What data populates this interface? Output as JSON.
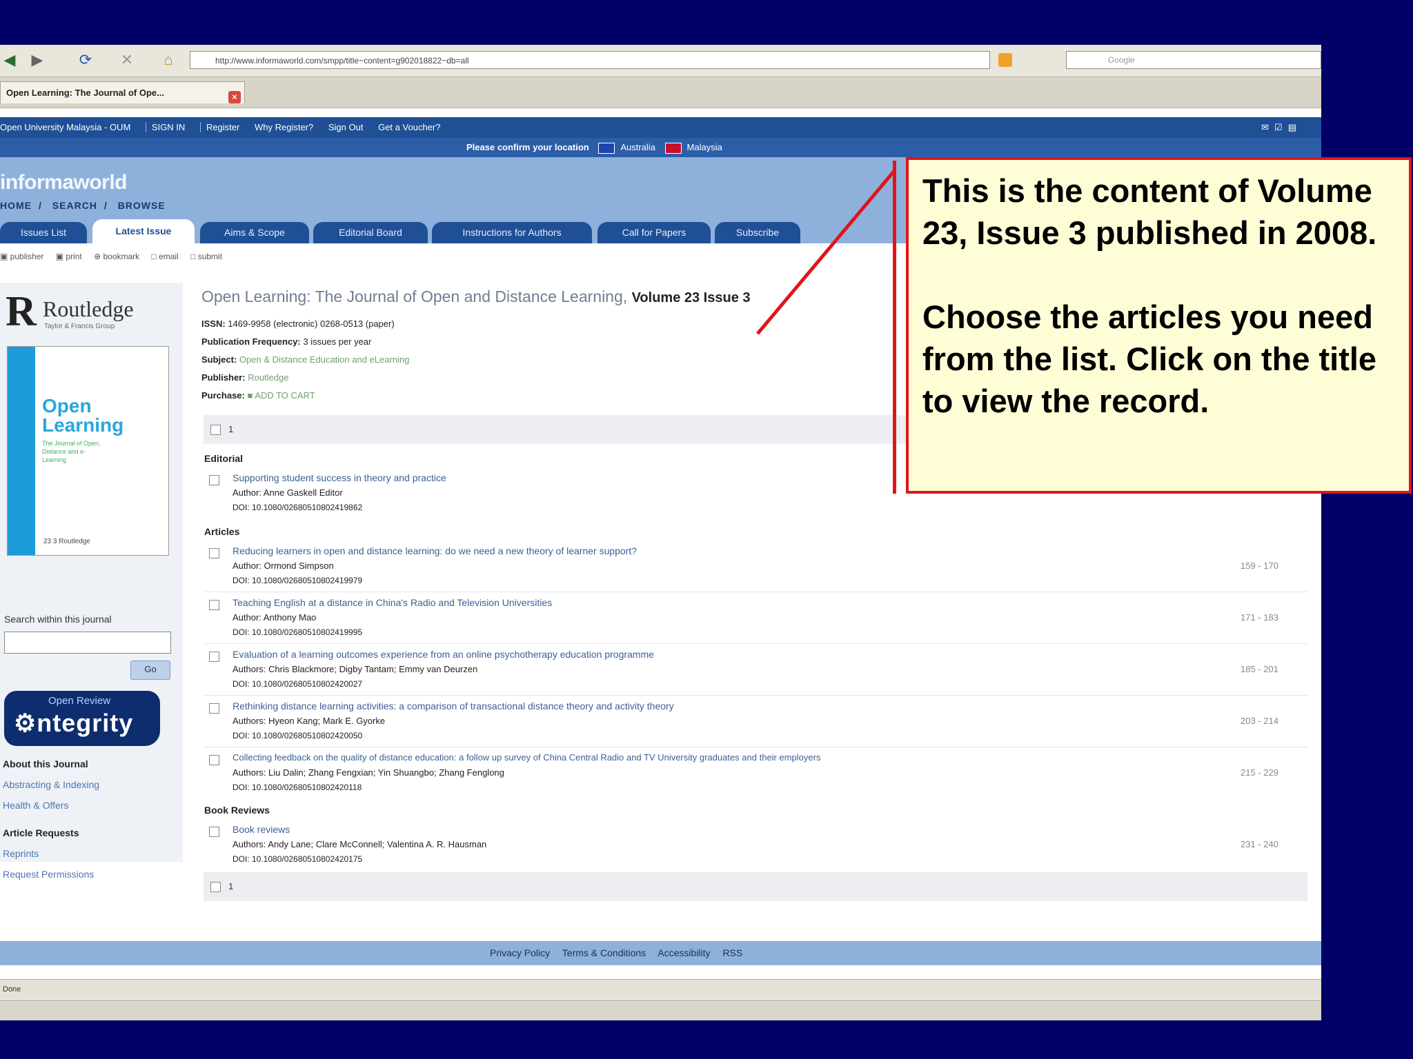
{
  "browser": {
    "url": "http://www.informaworld.com/smpp/title~content=g902018822~db=all",
    "search_placeholder": "Google",
    "tab_title": "Open Learning: The Journal of Ope..."
  },
  "site": {
    "top_bar": [
      "Open University Malaysia - OUM",
      "SIGN IN",
      "Register",
      "Why Register?",
      "Sign Out",
      "Get a Voucher?"
    ],
    "location_prompt": "Please confirm your location",
    "loc_option_1": "Australia",
    "loc_option_2": "Malaysia",
    "logo": "informaworld",
    "nav": [
      "HOME",
      "/",
      "SEARCH",
      "/",
      "BROWSE"
    ],
    "tabs": [
      "Issues List",
      "Latest Issue",
      "Aims & Scope",
      "Editorial Board",
      "Instructions for Authors",
      "Call for Papers",
      "Subscribe"
    ],
    "tools": [
      "▣ publisher",
      "▣ print",
      "⊕ bookmark",
      "□ email",
      "□ submit"
    ]
  },
  "sidebar": {
    "publisher_mark": "R",
    "publisher_name": "Routledge",
    "publisher_sub": "Taylor & Francis Group",
    "cover_title": "Open Learning",
    "cover_sub": "The Journal of Open, Distance and e-Learning",
    "cover_foot": "23 3  Routledge",
    "search_label": "Search within this journal",
    "go_label": "Go",
    "integrity_small": "Open Review",
    "integrity_big": "ntegrity",
    "about_heading": "About this Journal",
    "about_links": [
      "Abstracting & Indexing",
      "Health & Offers"
    ],
    "requests_heading": "Article Requests",
    "requests_links": [
      "Reprints",
      "Request Permissions"
    ]
  },
  "journal": {
    "title": "Open Learning: The Journal of Open and Distance Learning,",
    "issue": "Volume 23 Issue 3",
    "issn_label": "ISSN:",
    "issn_value": "1469-9958 (electronic) 0268-0513 (paper)",
    "freq_label": "Publication Frequency:",
    "freq_value": "3 issues per year",
    "subject_label": "Subject:",
    "subject_value": "Open & Distance Education and eLearning",
    "publisher_label": "Publisher:",
    "publisher_value": "Routledge",
    "purchase_label": "Purchase:",
    "purchase_value": "ADD TO CART",
    "page_num": "1",
    "page_num_bottom": "1"
  },
  "sections": {
    "editorial": "Editorial",
    "articles": "Articles",
    "book_reviews": "Book Reviews"
  },
  "articles": [
    {
      "title": "Supporting student success in theory and practice",
      "authors": "Author: Anne Gaskell Editor",
      "doi": "DOI: 10.1080/02680510802419862",
      "pages": ""
    },
    {
      "title": "Reducing learners in open and distance learning: do we need a new theory of learner support?",
      "authors": "Author: Ormond Simpson",
      "doi": "DOI: 10.1080/02680510802419979",
      "pages": "159 - 170"
    },
    {
      "title": "Teaching English at a distance in China's Radio and Television Universities",
      "authors": "Author: Anthony Mao",
      "doi": "DOI: 10.1080/02680510802419995",
      "pages": "171 - 183"
    },
    {
      "title": "Evaluation of a learning outcomes experience from an online psychotherapy education programme",
      "authors": "Authors: Chris Blackmore; Digby Tantam; Emmy van Deurzen",
      "doi": "DOI: 10.1080/02680510802420027",
      "pages": "185 - 201"
    },
    {
      "title": "Rethinking distance learning activities: a comparison of transactional distance theory and activity theory",
      "authors": "Authors: Hyeon Kang; Mark E. Gyorke",
      "doi": "DOI: 10.1080/02680510802420050",
      "pages": "203 - 214"
    },
    {
      "title": "Collecting feedback on the quality of distance education: a follow up survey of China Central Radio and TV University graduates and their employers",
      "authors": "Authors: Liu Dalin; Zhang Fengxian; Yin Shuangbo; Zhang Fenglong",
      "doi": "DOI: 10.1080/02680510802420118",
      "pages": "215 - 229"
    },
    {
      "title": "Book reviews",
      "authors": "Authors: Andy Lane; Clare McConnell; Valentina A. R. Hausman",
      "doi": "DOI: 10.1080/02680510802420175",
      "pages": "231 - 240"
    }
  ],
  "footer": [
    "Privacy Policy",
    "Terms & Conditions",
    "Accessibility",
    "RSS"
  ],
  "status": "Done",
  "callout": {
    "line1": "This is the content of Volume 23, Issue 3 published in 2008.",
    "line2": "Choose the articles you need from the list. Click on the title to view the record."
  },
  "colors": {
    "background": "#000066",
    "callout_border": "#e0141b",
    "callout_fill": "#fefdd6",
    "header_blue": "#1f4f95",
    "light_blue": "#8eb1dc"
  }
}
